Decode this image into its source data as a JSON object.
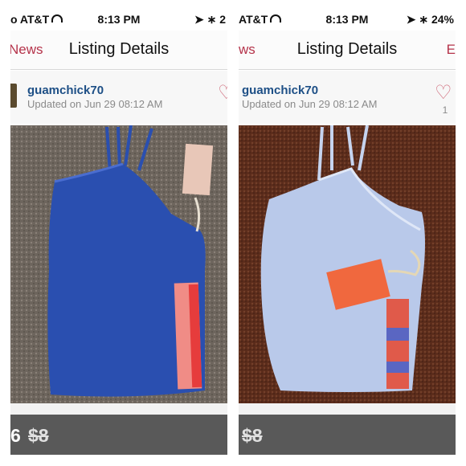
{
  "left": {
    "status": {
      "carrier": "o AT&T",
      "time": "8:13 PM",
      "right": "➤ ∗ 2"
    },
    "nav": {
      "back": "News",
      "title": "Listing Details"
    },
    "user": {
      "name": "guamchick70",
      "updated": "Updated on Jun 29 08:12 AM"
    },
    "price": {
      "current": "6",
      "original": "$8"
    },
    "item_color": "#2a4fb0"
  },
  "right": {
    "status": {
      "carrier": "AT&T",
      "time": "8:13 PM",
      "right": "➤ ∗ 24%"
    },
    "nav": {
      "back": "ws",
      "title": "Listing Details",
      "right": "E"
    },
    "user": {
      "name": "guamchick70",
      "updated": "Updated on Jun 29 08:12 AM",
      "likes": "1"
    },
    "price": {
      "original": "$8"
    },
    "item_color": "#b9c9ea"
  },
  "icons": {
    "heart": "heart-icon",
    "wifi": "wifi-icon",
    "location": "location-arrow-icon",
    "bluetooth": "bluetooth-icon"
  }
}
